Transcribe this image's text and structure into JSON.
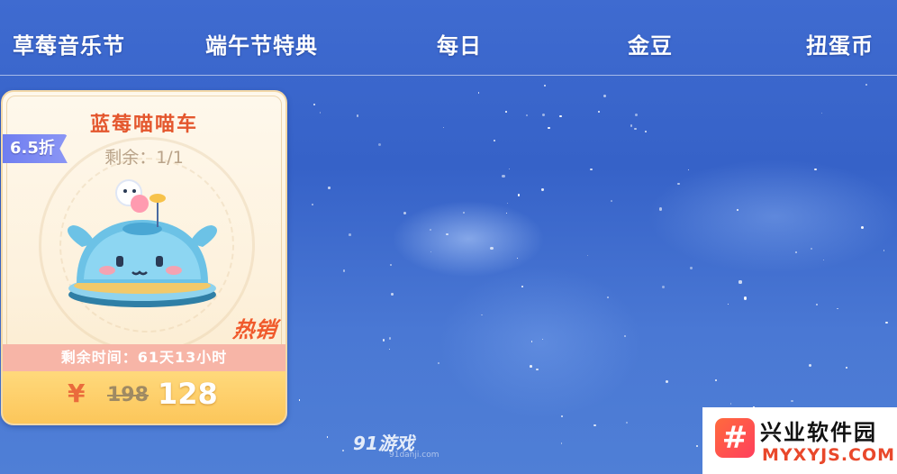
{
  "tabs": [
    {
      "label": "草莓音乐节"
    },
    {
      "label": "端午节特典"
    },
    {
      "label": "每日"
    },
    {
      "label": "金豆"
    },
    {
      "label": "扭蛋币"
    }
  ],
  "product_card": {
    "name": "蓝莓喵喵车",
    "stock": "剩余：1/1",
    "discount": "6.5折",
    "hot_tag": "热销",
    "time_left": "剩余时间：61天13小时",
    "currency_symbol": "¥",
    "original_price": "198",
    "price": "128",
    "image": "blueberry-cat-car-icon"
  },
  "watermarks": {
    "site_91": "91游戏",
    "site_91_domain": "91danji.com",
    "brand_glyph": "#",
    "brand_name": "兴业软件园",
    "brand_site": "MYXYJS.COM"
  },
  "colors": {
    "background": "#3f6bd0",
    "item_name": "#e4572e",
    "discount_badge": "#6f7ef0",
    "price_bar": "#fcc65a",
    "timer_bar": "#f7b5a7"
  }
}
